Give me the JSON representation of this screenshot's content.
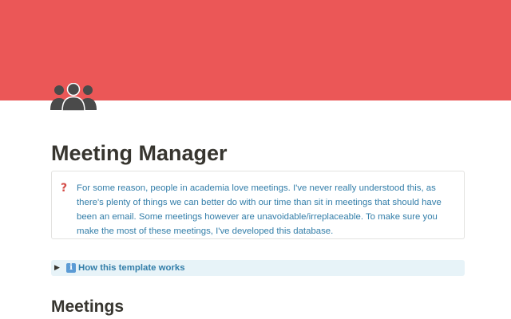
{
  "colors": {
    "cover": "#eb5757",
    "icon": "#4a4a4a",
    "callout_text": "#337ea9",
    "callout_icon": "#d44c47",
    "toggle_bg": "#e7f3f8",
    "info_badge": "#5b9bd5"
  },
  "page": {
    "icon": "people-group-icon",
    "title": "Meeting Manager"
  },
  "callout": {
    "icon": "question-mark-icon",
    "icon_glyph": "?",
    "text": "For some reason, people in academia love meetings. I've never really understood this, as there's plenty of things we can better do with our time than sit in meetings that should have been an email. Some meetings however are unavoidable/irreplaceable. To make sure you make the most of these meetings, I've developed this database."
  },
  "toggle": {
    "arrow_icon": "triangle-right-icon",
    "arrow_glyph": "▶",
    "info_icon": "information-icon",
    "info_glyph": "i",
    "label": "How this template works"
  },
  "sections": {
    "meetings_heading": "Meetings"
  }
}
